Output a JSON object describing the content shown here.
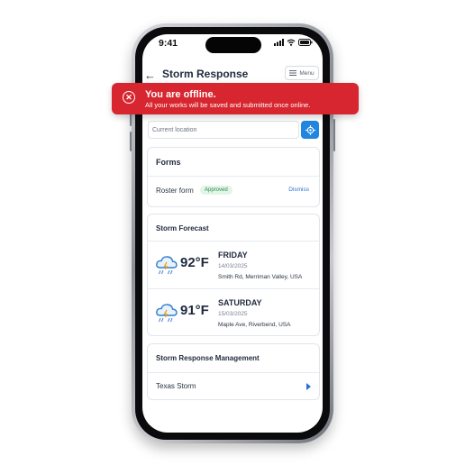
{
  "status_bar": {
    "time": "9:41"
  },
  "header": {
    "title": "Storm Response",
    "menu_label": "Menu"
  },
  "banner": {
    "title": "You are offline.",
    "message": "All your works will be saved and submitted once online.",
    "color": "#d7262f"
  },
  "location": {
    "placeholder": "Current location"
  },
  "forms": {
    "title": "Forms",
    "item": {
      "label": "Roster form",
      "status": "Approved",
      "action": "Dismiss"
    }
  },
  "forecast": {
    "title": "Storm Forecast",
    "days": [
      {
        "temp": "92°F",
        "day": "FRIDAY",
        "date": "14/03/2025",
        "address": "Smith Rd, Merriman Valley, USA",
        "icon": "storm-cloud-icon"
      },
      {
        "temp": "91°F",
        "day": "SATURDAY",
        "date": "15/03/2025",
        "address": "Maple Ave, Riverbend, USA",
        "icon": "storm-cloud-icon"
      }
    ]
  },
  "management": {
    "title": "Storm Response Management",
    "item": "Texas Storm"
  },
  "colors": {
    "accent": "#2186e0",
    "approved_bg": "#e3f5e7",
    "approved_text": "#2c8a45"
  }
}
